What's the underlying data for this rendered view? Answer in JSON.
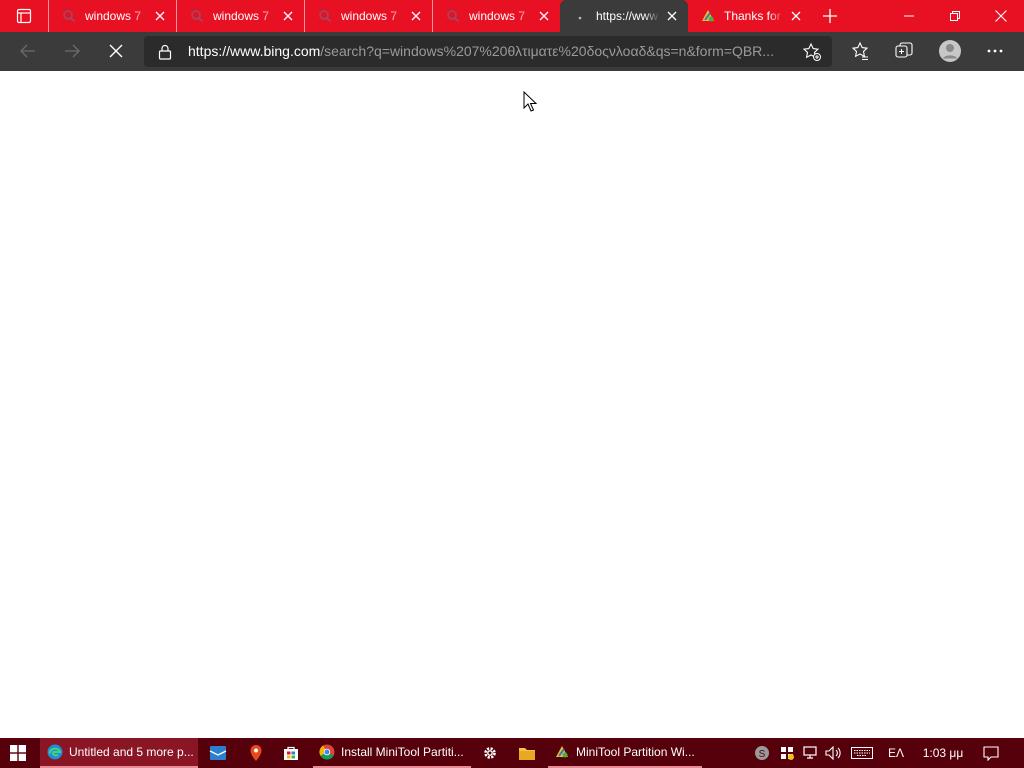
{
  "browser": {
    "tabs": [
      {
        "title": "windows 7",
        "favicon": "bing-icon",
        "active": false
      },
      {
        "title": "windows 7",
        "favicon": "bing-icon",
        "active": false
      },
      {
        "title": "windows 7",
        "favicon": "bing-icon",
        "active": false
      },
      {
        "title": "windows 7",
        "favicon": "bing-icon",
        "active": false
      },
      {
        "title": "https://www",
        "favicon": "loading-icon",
        "active": true
      },
      {
        "title": "Thanks for",
        "favicon": "minitool-icon",
        "active": false
      }
    ],
    "address_bar": {
      "url_host": "https://www.bing.com",
      "url_rest": "/search?q=windows%207%20θλτιματε%20δοςνλοαδ&qs=n&form=QBR..."
    }
  },
  "taskbar": {
    "apps": [
      {
        "label": "Untitled and 5 more p...",
        "icon": "edge-icon"
      },
      {
        "label": "Install MiniTool Partiti...",
        "icon": "chrome-icon"
      },
      {
        "label": "MiniTool Partition Wi...",
        "icon": "minitool-icon"
      }
    ],
    "language": "ΕΛ",
    "time": "1:03 μμ"
  },
  "colors": {
    "tabstrip": "#e81123",
    "toolbar": "#3b3b3b",
    "taskbar": "#55000a"
  }
}
